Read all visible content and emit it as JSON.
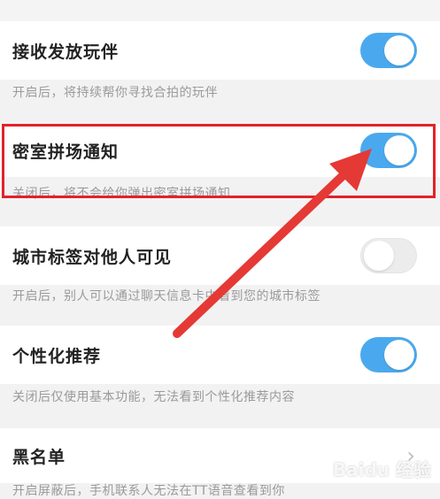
{
  "settings": [
    {
      "label": "接收发放玩伴",
      "desc": "开启后，将持续帮你寻找合拍的玩伴",
      "toggle": "on"
    },
    {
      "label": "密室拼场通知",
      "desc": "关闭后，将不会给你弹出密室拼场通知",
      "toggle": "on"
    },
    {
      "label": "城市标签对他人可见",
      "desc": "开启后，别人可以通过聊天信息卡中看到您的城市标签",
      "toggle": "off"
    },
    {
      "label": "个性化推荐",
      "desc": "关闭后仅使用基本功能，无法看到个性化推荐内容",
      "toggle": "on"
    },
    {
      "label": "黑名单",
      "desc": "开启屏蔽后，手机联系人无法在TT语音查看到你"
    }
  ],
  "colors": {
    "toggle_on": "#4aa9ee",
    "highlight": "#e0232a",
    "arrow": "#e53935"
  },
  "icons": {
    "chevron": "chevron-right-icon"
  },
  "watermark": "Baidu 经验"
}
